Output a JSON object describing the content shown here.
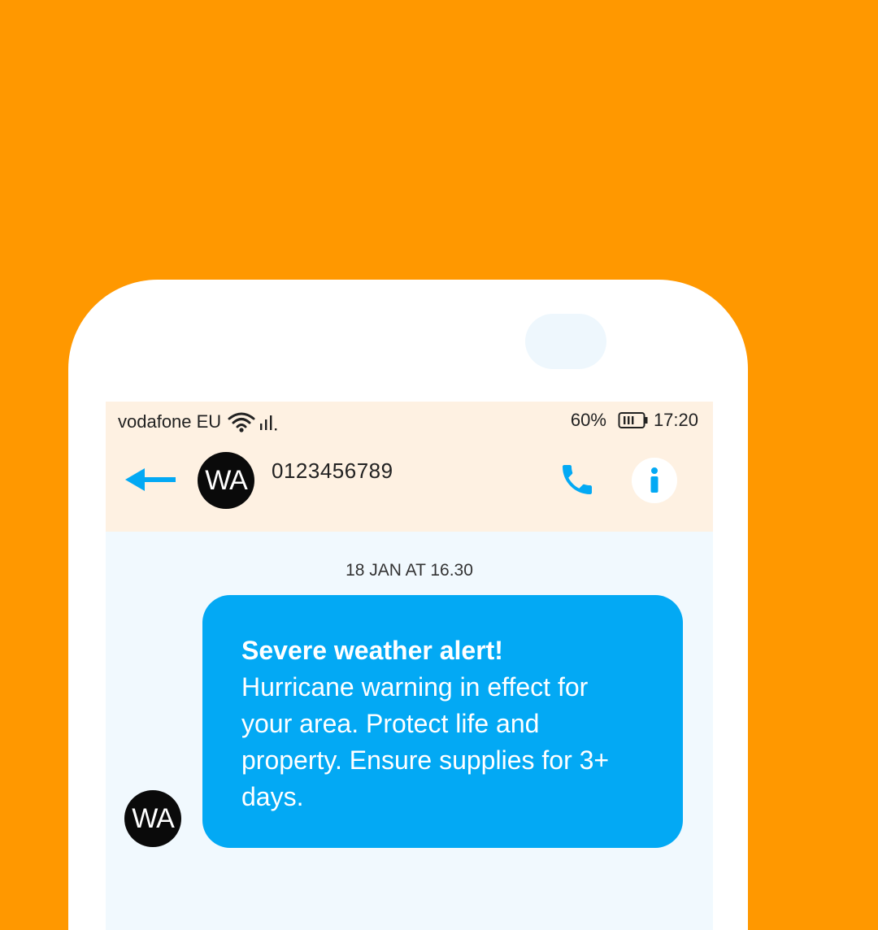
{
  "status_bar": {
    "carrier": "vodafone EU",
    "battery_percent": "60%",
    "time": "17:20"
  },
  "header": {
    "avatar_initials": "WA",
    "contact_number": "0123456789"
  },
  "conversation": {
    "timestamp": "18 JAN AT 16.30",
    "message": {
      "title": "Severe weather alert!",
      "body": "Hurricane warning in effect for your area. Protect life and property. Ensure supplies for 3+ days.",
      "avatar_initials": "WA"
    }
  },
  "colors": {
    "background": "#FF9800",
    "accent": "#03A9F4",
    "header_bg": "#FEF1E2",
    "chat_bg": "#F1F9FE"
  },
  "icons": [
    "wifi-icon",
    "signal-icon",
    "battery-icon",
    "back-arrow-icon",
    "phone-icon",
    "info-icon"
  ]
}
